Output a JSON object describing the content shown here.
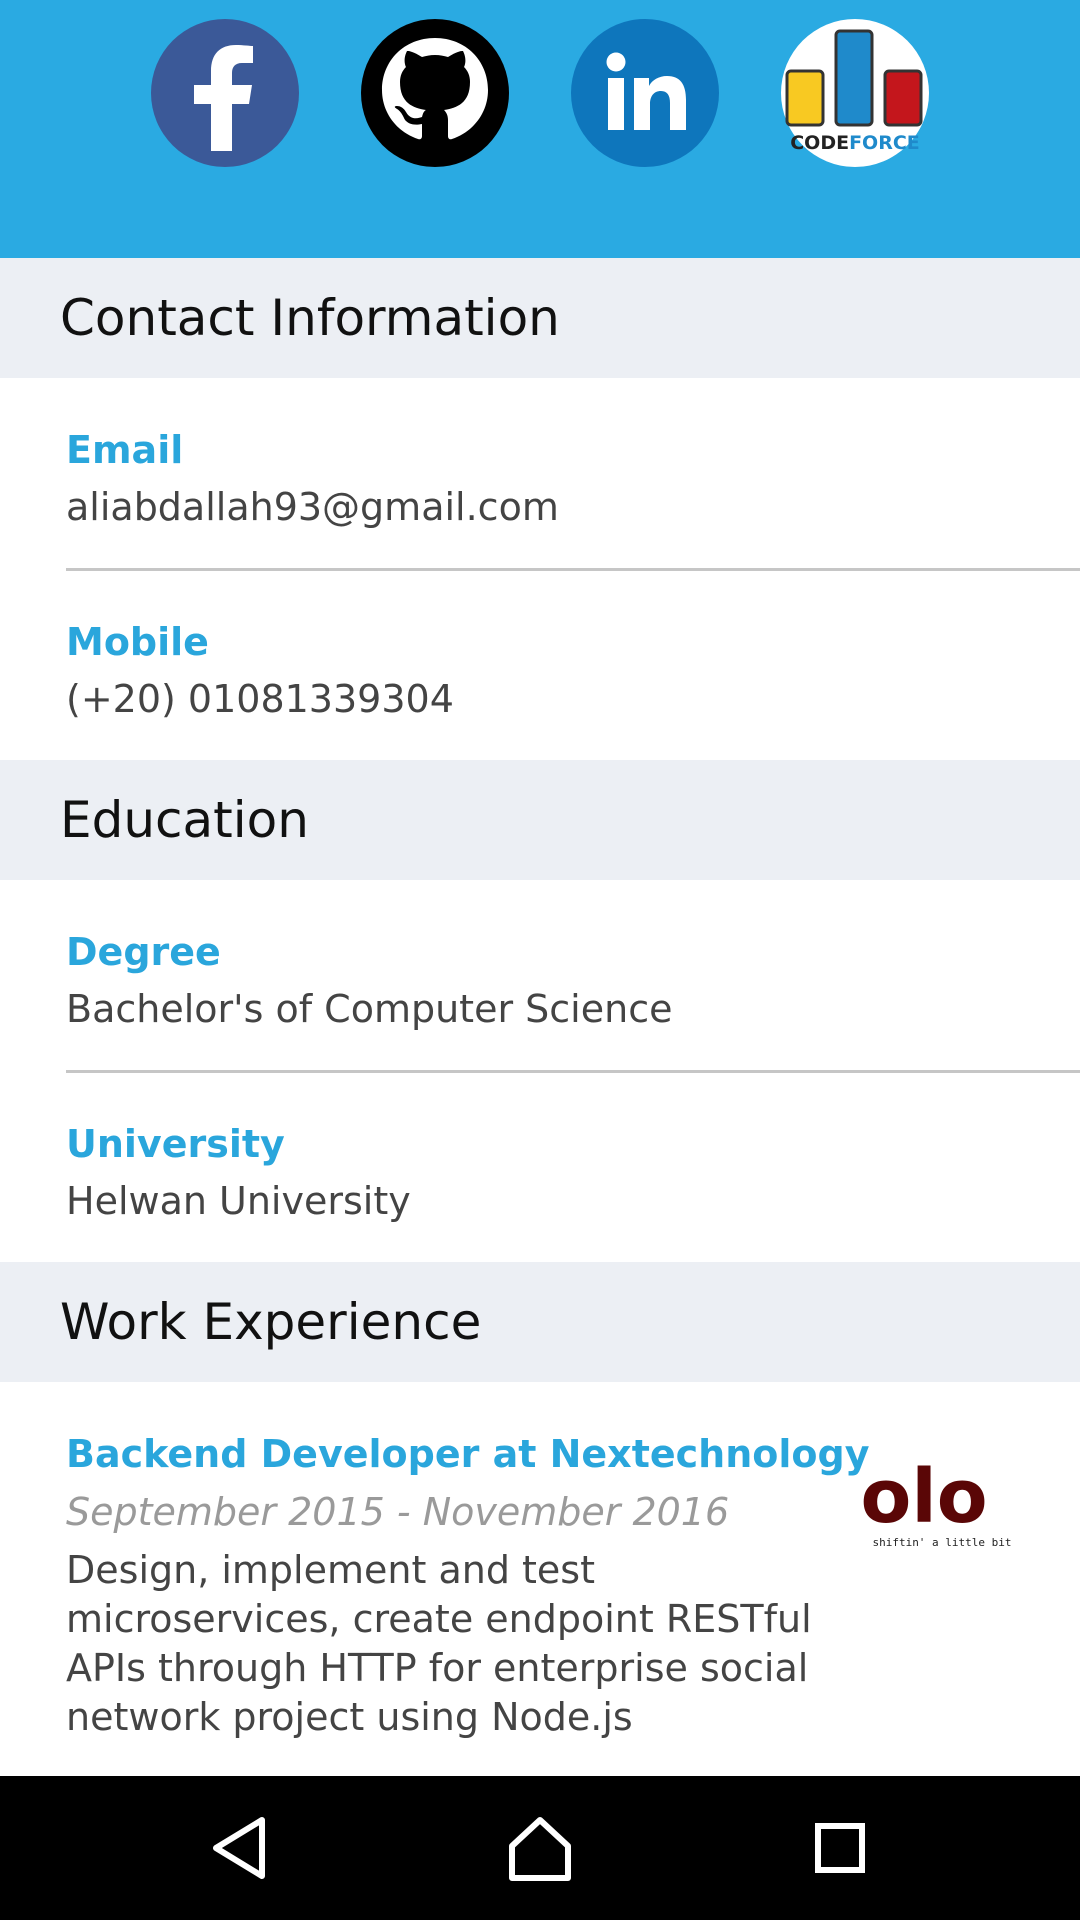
{
  "header": {
    "social_icons": [
      "facebook-icon",
      "github-icon",
      "linkedin-icon",
      "codeforces-icon"
    ],
    "codeforces_wordmark": {
      "code": "CODE",
      "force": "FORCE"
    },
    "colors": {
      "background": "#2aaae2",
      "facebook": "#3b5998",
      "linkedin": "#0e76bc",
      "github": "#000000"
    }
  },
  "contact": {
    "title": "Contact Information",
    "email_label": "Email",
    "email_value": "aliabdallah93@gmail.com",
    "mobile_label": "Mobile",
    "mobile_value": "(+20) 01081339304"
  },
  "education": {
    "title": "Education",
    "degree_label": "Degree",
    "degree_value": "Bachelor's of Computer Science",
    "university_label": "University",
    "university_value": "Helwan University"
  },
  "work": {
    "title": "Work Experience",
    "jobs": [
      {
        "title": "Backend Developer at Nextechnology",
        "dates": "September 2015 - November 2016",
        "description": "Design, implement and test microservices, create endpoint RESTful APIs through HTTP for enterprise social network project using Node.js",
        "logo_text": "olo",
        "logo_tagline": "shiftin' a little bit"
      }
    ]
  },
  "navbar": {
    "buttons": [
      "back-icon",
      "home-icon",
      "recents-icon"
    ]
  },
  "theme": {
    "accent": "#2aa6dc",
    "section_bg": "#eceff4",
    "logo_color": "#5a0606"
  }
}
